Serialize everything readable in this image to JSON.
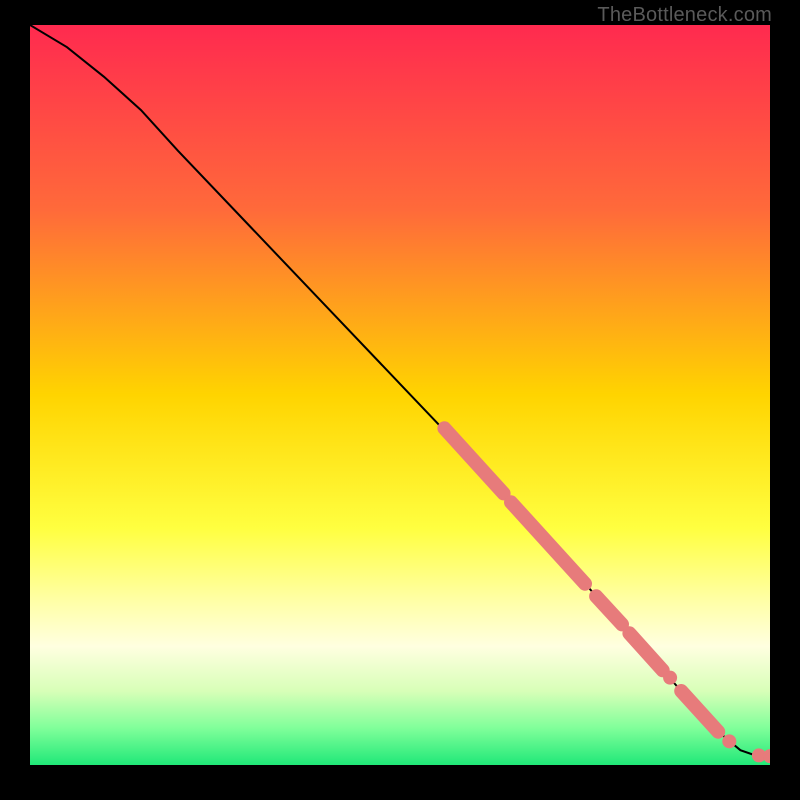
{
  "watermark": "TheBottleneck.com",
  "chart_data": {
    "type": "line",
    "title": "",
    "xlabel": "",
    "ylabel": "",
    "xlim": [
      0,
      100
    ],
    "ylim": [
      0,
      100
    ],
    "gradient_stops": [
      {
        "offset": 0,
        "color": "#ff2a4f"
      },
      {
        "offset": 25,
        "color": "#ff6a3a"
      },
      {
        "offset": 50,
        "color": "#ffd400"
      },
      {
        "offset": 68,
        "color": "#ffff40"
      },
      {
        "offset": 78,
        "color": "#ffffa8"
      },
      {
        "offset": 84,
        "color": "#ffffe0"
      },
      {
        "offset": 90,
        "color": "#d8ffb8"
      },
      {
        "offset": 95,
        "color": "#80ff9a"
      },
      {
        "offset": 100,
        "color": "#20e878"
      }
    ],
    "curve_points": [
      {
        "x": 0,
        "y": 100
      },
      {
        "x": 5,
        "y": 97
      },
      {
        "x": 10,
        "y": 93
      },
      {
        "x": 15,
        "y": 88.5
      },
      {
        "x": 20,
        "y": 83
      },
      {
        "x": 30,
        "y": 72.5
      },
      {
        "x": 40,
        "y": 62
      },
      {
        "x": 50,
        "y": 51.5
      },
      {
        "x": 60,
        "y": 41
      },
      {
        "x": 70,
        "y": 30
      },
      {
        "x": 80,
        "y": 19
      },
      {
        "x": 88,
        "y": 10
      },
      {
        "x": 93,
        "y": 4.5
      },
      {
        "x": 96,
        "y": 2
      },
      {
        "x": 98,
        "y": 1.3
      },
      {
        "x": 100,
        "y": 1.2
      }
    ],
    "highlighted_segments": [
      {
        "x1": 56,
        "y1": 45.5,
        "x2": 64,
        "y2": 36.7
      },
      {
        "x1": 65,
        "y1": 35.5,
        "x2": 75,
        "y2": 24.5
      },
      {
        "x1": 76.5,
        "y1": 22.8,
        "x2": 80,
        "y2": 19
      },
      {
        "x1": 81,
        "y1": 17.8,
        "x2": 85.5,
        "y2": 12.8
      },
      {
        "x1": 88,
        "y1": 10,
        "x2": 93,
        "y2": 4.5
      }
    ],
    "highlighted_dots": [
      {
        "x": 86.5,
        "y": 11.8
      },
      {
        "x": 94.5,
        "y": 3.2
      },
      {
        "x": 98.5,
        "y": 1.3
      },
      {
        "x": 100,
        "y": 1.2
      }
    ]
  }
}
